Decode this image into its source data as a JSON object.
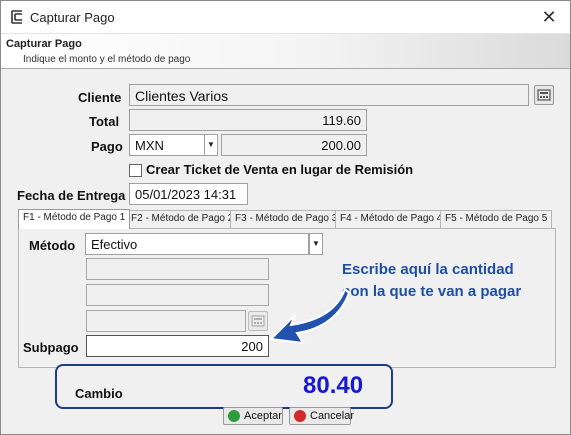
{
  "window": {
    "title": "Capturar Pago",
    "close_symbol": "✕"
  },
  "header": {
    "title": "Capturar Pago",
    "subtitle": "Indique el monto y el método de pago"
  },
  "form": {
    "cliente": {
      "label": "Cliente",
      "value": "Clientes Varios"
    },
    "total": {
      "label": "Total",
      "value": "119.60"
    },
    "pago": {
      "label": "Pago",
      "currency": "MXN",
      "amount": "200.00"
    },
    "crear_ticket": {
      "label": "Crear Ticket de Venta en lugar de Remisión",
      "checked": false
    },
    "fecha_entrega": {
      "label": "Fecha de Entrega",
      "value": "05/01/2023 14:31"
    }
  },
  "tabs": [
    {
      "label": "F1 - Método de Pago 1",
      "active": true
    },
    {
      "label": "F2 - Método de Pago 2",
      "active": false
    },
    {
      "label": "F3 - Método de Pago 3",
      "active": false
    },
    {
      "label": "F4 - Método de Pago 4",
      "active": false
    },
    {
      "label": "F5 - Método de Pago 5",
      "active": false
    }
  ],
  "payment_panel": {
    "metodo": {
      "label": "Método",
      "value": "Efectivo"
    },
    "subpago": {
      "label": "Subpago",
      "value": "200"
    }
  },
  "annotation": {
    "line1": "Escribe aquí la cantidad",
    "line2": "con la que te van a pagar"
  },
  "cambio": {
    "label": "Cambio",
    "value": "80.40"
  },
  "buttons": {
    "accept": "Aceptar",
    "cancel": "Cancelar"
  },
  "colors": {
    "annotation": "#1f4fa3",
    "cambio_value": "#1717d6",
    "accept_icon": "#2e9e3a",
    "cancel_icon": "#d12b2b"
  },
  "icons": {
    "app": "window-icon",
    "calculator": "calculator-icon",
    "arrow": "curved-arrow-icon"
  }
}
